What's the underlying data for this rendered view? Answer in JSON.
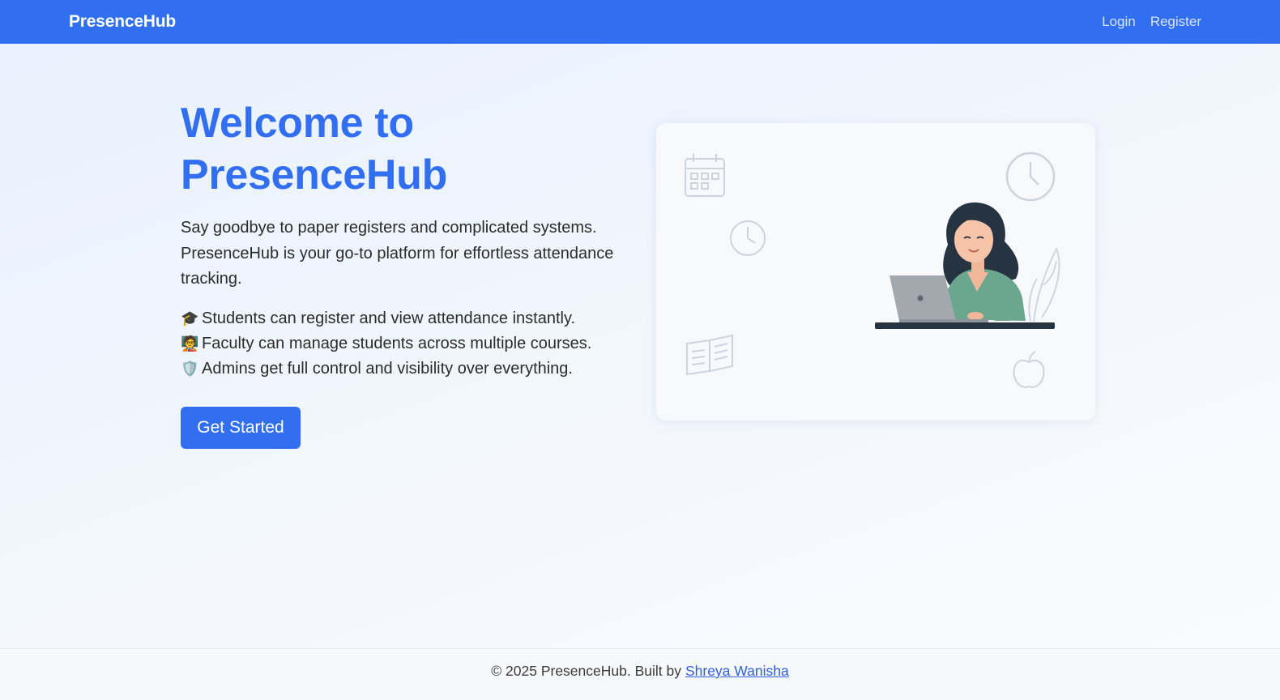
{
  "navbar": {
    "brand": "PresenceHub",
    "links": [
      {
        "label": "Login"
      },
      {
        "label": "Register"
      }
    ]
  },
  "hero": {
    "title_line1": "Welcome to",
    "title_line2": "PresenceHub",
    "description": "Say goodbye to paper registers and complicated systems. PresenceHub is your go-to platform for effortless attendance tracking.",
    "features": [
      {
        "icon": "🎓",
        "icon_name": "graduation-cap-icon",
        "text": "Students can register and view attendance instantly."
      },
      {
        "icon": "🧑‍🏫",
        "icon_name": "teacher-icon",
        "text": "Faculty can manage students across multiple courses."
      },
      {
        "icon": "🛡️",
        "icon_name": "shield-icon",
        "text": "Admins get full control and visibility over everything."
      }
    ],
    "cta_label": "Get Started"
  },
  "illustration": {
    "icons": [
      "calendar-icon",
      "clock-icon",
      "small-clock-icon",
      "book-icon",
      "apple-icon",
      "plant-icon",
      "laptop-icon",
      "woman-figure"
    ]
  },
  "footer": {
    "text": "© 2025 PresenceHub. Built by",
    "author_link": "Shreya Wanisha"
  },
  "colors": {
    "primary": "#326ff0",
    "nav_link": "#d8e3fb",
    "text": "#2b2b2b",
    "footer_bg": "#f7f8fa",
    "link": "#2f5fe0"
  }
}
